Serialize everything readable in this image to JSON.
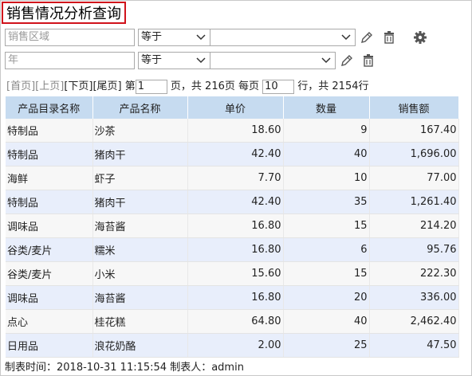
{
  "title": "销售情况分析查询",
  "filters": [
    {
      "field_placeholder": "销售区域",
      "operator": "等于",
      "value": ""
    },
    {
      "field_placeholder": "年",
      "operator": "等于",
      "value": ""
    }
  ],
  "pager": {
    "first": "[首页]",
    "prev": "[上页]",
    "next": "[下页]",
    "last": "[尾页]",
    "page_prefix": "第",
    "page": "1",
    "total_text": "页，共 216页 每页",
    "per_page": "10",
    "rows_text": "行，共 2154行"
  },
  "table": {
    "columns": [
      "产品目录名称",
      "产品名称",
      "单价",
      "数量",
      "销售额"
    ],
    "rows": [
      [
        "特制品",
        "沙茶",
        "18.60",
        "9",
        "167.40"
      ],
      [
        "特制品",
        "猪肉干",
        "42.40",
        "40",
        "1,696.00"
      ],
      [
        "海鲜",
        "虾子",
        "7.70",
        "10",
        "77.00"
      ],
      [
        "特制品",
        "猪肉干",
        "42.40",
        "35",
        "1,261.40"
      ],
      [
        "调味品",
        "海苔酱",
        "16.80",
        "15",
        "214.20"
      ],
      [
        "谷类/麦片",
        "糯米",
        "16.80",
        "6",
        "95.76"
      ],
      [
        "谷类/麦片",
        "小米",
        "15.60",
        "15",
        "222.30"
      ],
      [
        "调味品",
        "海苔酱",
        "16.80",
        "20",
        "336.00"
      ],
      [
        "点心",
        "桂花糕",
        "64.80",
        "40",
        "2,462.40"
      ],
      [
        "日用品",
        "浪花奶酪",
        "2.00",
        "25",
        "47.50"
      ]
    ]
  },
  "footer": "制表时间：2018-10-31 11:15:54 制表人：admin",
  "icons": [
    "edit-icon",
    "delete-icon",
    "settings-icon",
    "chevron-down-icon"
  ],
  "colors": {
    "title_border": "#d0121b",
    "header_bg": "#c6dbf0",
    "row_alt_bg": "#e8eefb"
  }
}
